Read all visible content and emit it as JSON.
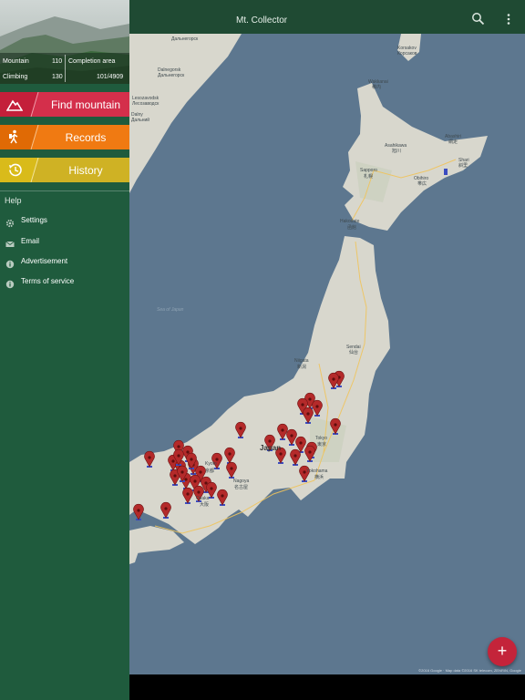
{
  "app": {
    "title": "Mt. Collector"
  },
  "toolbar": {
    "search_icon": "search-icon",
    "more_icon": "more-vert-icon"
  },
  "stats": {
    "mountain_label": "Mountain",
    "mountain_value": "110",
    "climbing_label": "Climbing",
    "climbing_value": "130",
    "completion_label": "Completion area",
    "completion_value": "101/4909"
  },
  "menu": {
    "find": {
      "label": "Find mountain",
      "color": "#d42f4b",
      "icon": "mountain-icon"
    },
    "records": {
      "label": "Records",
      "color": "#f07a12",
      "icon": "hiker-icon"
    },
    "history": {
      "label": "History",
      "color": "#cfb224",
      "icon": "history-icon"
    }
  },
  "help": {
    "title": "Help",
    "items": [
      {
        "label": "Settings",
        "icon": "gear-icon"
      },
      {
        "label": "Email",
        "icon": "mail-icon"
      },
      {
        "label": "Advertisement",
        "icon": "info-icon"
      },
      {
        "label": "Terms of service",
        "icon": "info-icon"
      }
    ]
  },
  "map": {
    "labels": {
      "sapporo": "Sapporo",
      "sapporo_jp": "札幌",
      "asahikawa": "Asahikawa",
      "asahikawa_jp": "旭川",
      "obihiro": "Obihiro",
      "obihiro_jp": "帯広",
      "hakodate": "Hakodate",
      "hakodate_jp": "函館",
      "shari": "Shari",
      "shari_jp": "斜里",
      "abashiri": "Abashiri",
      "abashiri_jp": "網走",
      "wakkanai": "Wakkanai",
      "wakkanai_jp": "稚内",
      "korsakov": "Korsakov",
      "korsakov_ru": "Корсаков",
      "dalnegorsk": "Dalnegorsk",
      "dalnegorsk_ru": "Дальнегорск",
      "lesozavodsk": "Lesozavodsk",
      "lesozavodsk_ru": "Лесозаводск",
      "dalny": "Dalny",
      "dalny_ru": "Дальний",
      "sendai": "Sendai",
      "sendai_jp": "仙台",
      "niigata": "Niigata",
      "niigata_jp": "新潟",
      "tokyo": "Tokyo",
      "tokyo_jp": "東京",
      "yokohama": "Yokohama",
      "yokohama_jp": "横浜",
      "nagoya": "Nagoya",
      "nagoya_jp": "名古屋",
      "osaka": "Osaka",
      "osaka_jp": "大阪",
      "kyoto": "Kyoto",
      "kyoto_jp": "京都",
      "japan": "Japan",
      "sea_of_japan": "Sea of Japan"
    },
    "attribution": "©2016 Google · Map data ©2016 SK telecom, ZENRIN, Google"
  },
  "fab": {
    "label": "+"
  }
}
